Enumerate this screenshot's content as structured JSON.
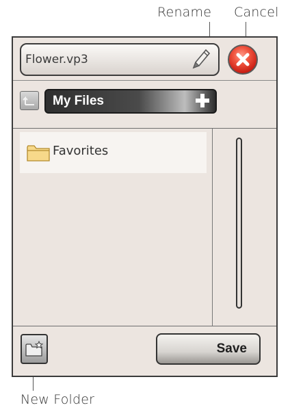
{
  "callouts": {
    "rename": "Rename",
    "cancel": "Cancel",
    "new_folder": "New Folder"
  },
  "dialog": {
    "file_name": "Flower.vp3",
    "rename_icon": "pencil-icon",
    "cancel_icon": "close-icon",
    "current_path": "My Files",
    "up_icon": "folder-up-icon",
    "add_icon": "plus-icon",
    "items": [
      {
        "label": "Favorites",
        "icon": "folder-icon"
      }
    ],
    "new_folder_icon": "new-folder-icon",
    "save_label": "Save"
  },
  "colors": {
    "panel_bg": "#ece5e0",
    "cancel_red": "#d9321f",
    "path_bar_dark": "#2f2f2f",
    "selected_item_bg": "#f7f4f1"
  }
}
